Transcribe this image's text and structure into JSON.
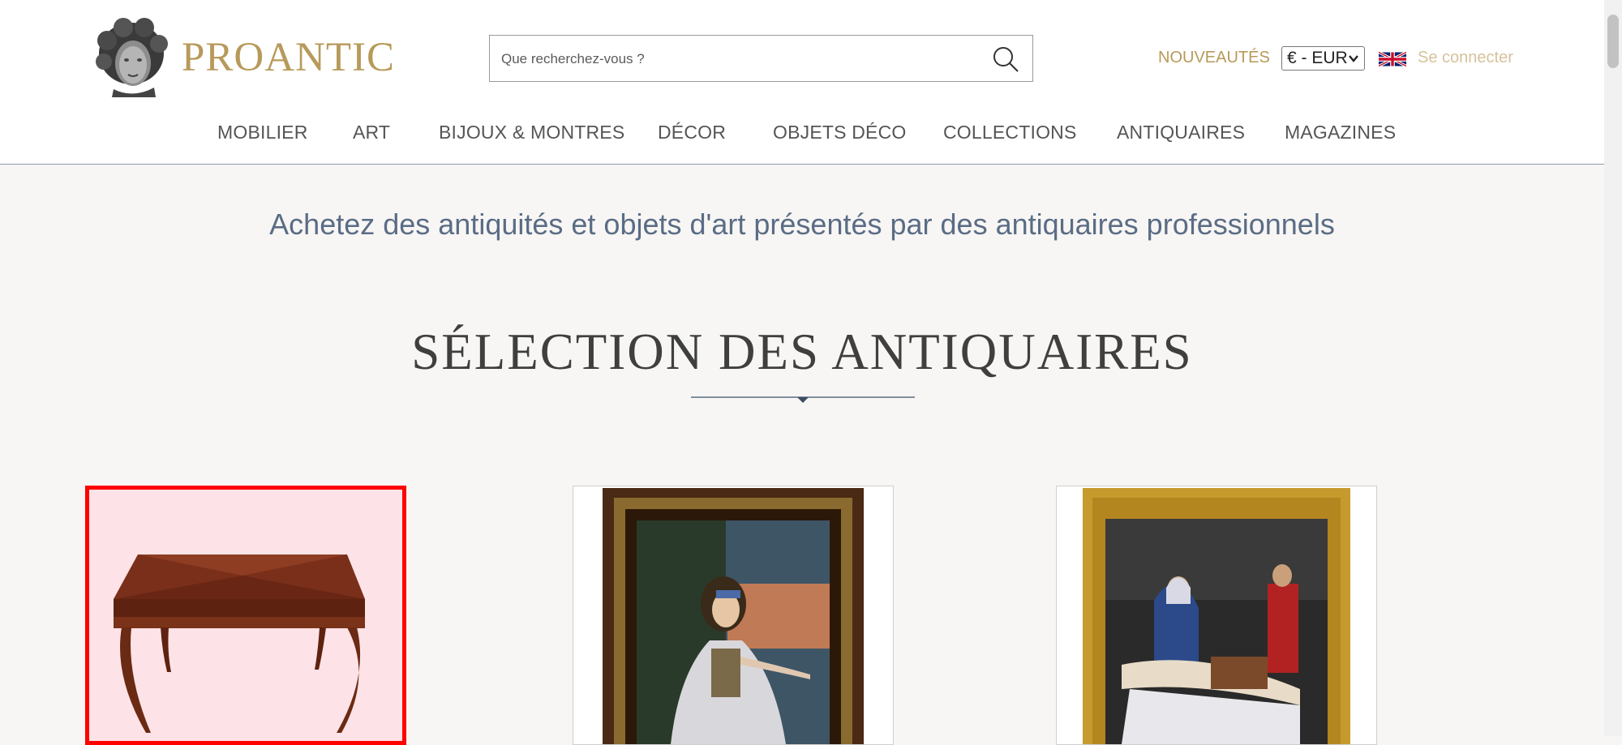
{
  "header": {
    "brand": "PROANTIC",
    "search_placeholder": "Que recherchez-vous ?",
    "nouveautes": "NOUVEAUTÉS",
    "currency": "€ - EUR",
    "login": "Se connecter"
  },
  "nav": {
    "items": [
      "MOBILIER",
      "ART",
      "BIJOUX & MONTRES",
      "DÉCOR",
      "OBJETS DÉCO",
      "COLLECTIONS",
      "ANTIQUAIRES",
      "MAGAZINES"
    ]
  },
  "main": {
    "tagline": "Achetez des antiquités et objets d'art présentés par des antiquaires professionnels",
    "section_title": "SÉLECTION DES ANTIQUAIRES"
  },
  "colors": {
    "brand_gold": "#b79a5a",
    "tagline_blue": "#5a6c85",
    "highlight_red": "#ff0000"
  },
  "icons": [
    "bust-logo-icon",
    "search-icon",
    "chevron-down-icon",
    "uk-flag-icon",
    "diamond-divider-icon"
  ]
}
